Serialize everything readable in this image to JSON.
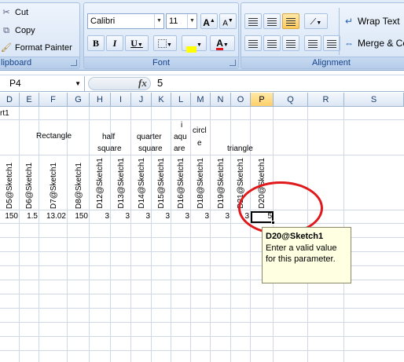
{
  "ribbon": {
    "clipboard": {
      "cut_label": "Cut",
      "copy_label": "Copy",
      "format_painter_label": "Format Painter",
      "group_label": "lipboard"
    },
    "font": {
      "font_name": "Calibri",
      "font_size": "11",
      "grow_label": "A",
      "shrink_label": "A",
      "bold_label": "B",
      "italic_label": "I",
      "underline_label": "U",
      "font_color_label": "A",
      "group_label": "Font"
    },
    "alignment": {
      "wrap_text_label": "Wrap Text",
      "merge_label": "Merge & Ce",
      "group_label": "Alignment"
    }
  },
  "formula_bar": {
    "name_box": "P4",
    "fx_label": "fx",
    "value": "5"
  },
  "columns": [
    "D",
    "E",
    "F",
    "G",
    "H",
    "I",
    "J",
    "K",
    "L",
    "M",
    "N",
    "O",
    "P",
    "Q",
    "R",
    "S"
  ],
  "selected_column": "P",
  "sheet": {
    "row1_text": "rt1",
    "group_labels": {
      "rectangle": "Rectangle",
      "half": "half",
      "square1": "square",
      "quarter": "quarter",
      "square2": "square",
      "i": "i",
      "aqu": "aqu",
      "are": "are",
      "circl": "circl",
      "e": "e",
      "triangle": "triangle"
    },
    "headers": [
      "D5@Sketch1",
      "D6@Sketch1",
      "D7@Sketch1",
      "D8@Sketch1",
      "D12@Sketch1",
      "D13@Sketch1",
      "D14@Sketch1",
      "D15@Sketch1",
      "D16@Sketch1",
      "D18@Sketch1",
      "D19@Sketch1",
      "D21@Sketch1",
      "D20@Sketch1"
    ],
    "values": [
      "150",
      "1.5",
      "13.02",
      "150",
      "3",
      "3",
      "3",
      "3",
      "3",
      "3",
      "3",
      "3",
      "5"
    ]
  },
  "tooltip": {
    "title": "D20@Sketch1",
    "line1": "Enter a valid value",
    "line2": "for this parameter."
  },
  "colors": {
    "annotation": "#e0191c",
    "tooltip_bg": "#ffffe1",
    "selected_header": "#ffcf6a"
  }
}
